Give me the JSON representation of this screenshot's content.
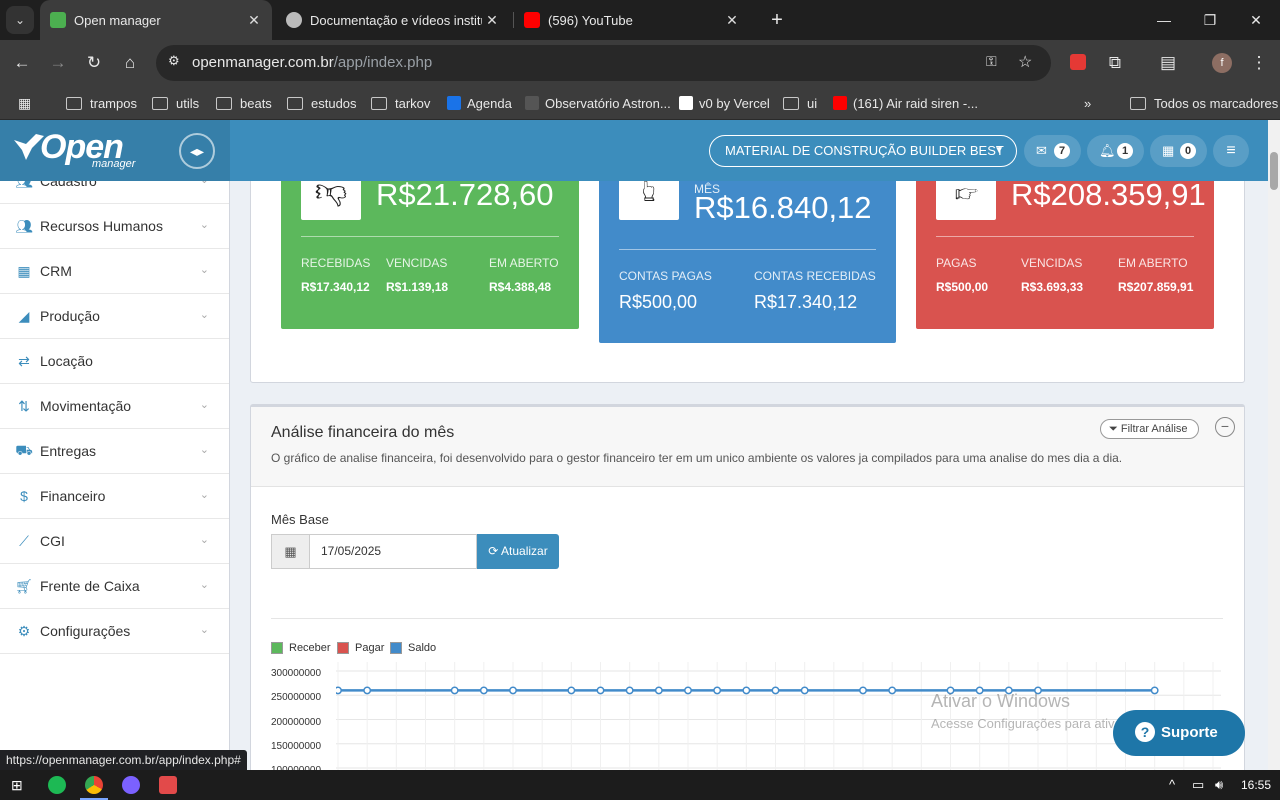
{
  "browser": {
    "tabs": [
      {
        "title": "Open manager",
        "active": true
      },
      {
        "title": "Documentação e vídeos instituc",
        "active": false
      },
      {
        "title": "(596) YouTube",
        "active": false
      }
    ],
    "url_host": "openmanager.com.br",
    "url_path": "/app/index.php",
    "bookmarks": [
      "trampos",
      "utils",
      "beats",
      "estudos",
      "tarkov",
      "Agenda",
      "Observatório Astron...",
      "v0 by Vercel",
      "ui",
      "(161) Air raid siren -..."
    ],
    "all_bookmarks": "Todos os marcadores",
    "status_url": "https://openmanager.com.br/app/index.php#"
  },
  "header": {
    "logo": "Open",
    "logo_sub": "manager",
    "company": "MATERIAL DE CONSTRUÇÃO BUILDER BEST",
    "messages_count": "7",
    "notifications_count": "1",
    "calendar_count": "0"
  },
  "sidebar": {
    "items": [
      {
        "label": "Cadastro",
        "icon": "users-icon"
      },
      {
        "label": "Recursos Humanos",
        "icon": "users-icon"
      },
      {
        "label": "CRM",
        "icon": "calendar-icon"
      },
      {
        "label": "Produção",
        "icon": "chart-icon"
      },
      {
        "label": "Locação",
        "icon": "exchange-icon"
      },
      {
        "label": "Movimentação",
        "icon": "sort-icon"
      },
      {
        "label": "Entregas",
        "icon": "truck-icon"
      },
      {
        "label": "Financeiro",
        "icon": "dollar-icon"
      },
      {
        "label": "CGI",
        "icon": "line-chart-icon"
      },
      {
        "label": "Frente de Caixa",
        "icon": "cart-icon"
      },
      {
        "label": "Configurações",
        "icon": "gear-icon"
      }
    ]
  },
  "kpis": {
    "green": {
      "value": "R$21.728,60",
      "labels": [
        "RECEBIDAS",
        "VENCIDAS",
        "EM ABERTO"
      ],
      "values": [
        "R$17.340,12",
        "R$1.139,18",
        "R$4.388,48"
      ],
      "color": "#5cb85c"
    },
    "blue": {
      "period": "MÊS",
      "value": "R$16.840,12",
      "labels": [
        "CONTAS PAGAS",
        "CONTAS RECEBIDAS"
      ],
      "values": [
        "R$500,00",
        "R$17.340,12"
      ],
      "color": "#428bca"
    },
    "red": {
      "value": "R$208.359,91",
      "labels": [
        "PAGAS",
        "VENCIDAS",
        "EM ABERTO"
      ],
      "values": [
        "R$500,00",
        "R$3.693,33",
        "R$207.859,91"
      ],
      "color": "#d9534f"
    }
  },
  "analysis": {
    "title": "Análise financeira do mês",
    "description": "O gráfico de analise financeira, foi desenvolvido para o gestor financeiro ter em um unico ambiente os valores ja compilados para uma analise do mes dia a dia.",
    "filter_label": "Filtrar Análise",
    "base_month_label": "Mês Base",
    "base_date": "17/05/2025",
    "update_label": "Atualizar"
  },
  "chart_data": {
    "type": "line",
    "series": [
      {
        "name": "Receber",
        "color": "#5cb85c",
        "values": []
      },
      {
        "name": "Pagar",
        "color": "#d9534f",
        "values": []
      },
      {
        "name": "Saldo",
        "color": "#428bca",
        "values": [
          260000000,
          260000000,
          260000000,
          260000000,
          260000000,
          260000000,
          260000000,
          260000000,
          260000000,
          260000000,
          260000000,
          260000000,
          260000000,
          260000000,
          260000000,
          260000000,
          260000000,
          260000000,
          260000000,
          260000000,
          260000000
        ]
      },
      {
        "name": "",
        "color": "#428bca",
        "values": []
      }
    ],
    "x_points": [
      0,
      1,
      4,
      5,
      6,
      8,
      9,
      10,
      11,
      12,
      13,
      14,
      15,
      16,
      18,
      19,
      21,
      22,
      23,
      24,
      28,
      30
    ],
    "y_ticks": [
      "300000000",
      "250000000",
      "200000000",
      "150000000",
      "100000000"
    ],
    "ylim": [
      100000000,
      300000000
    ],
    "grid": true,
    "legend": "top-left"
  },
  "watermark": {
    "line1": "Ativar o Windows",
    "line2": "Acesse Configurações para ativar o Windows."
  },
  "support_label": "Suporte",
  "taskbar": {
    "time": "16:55"
  }
}
